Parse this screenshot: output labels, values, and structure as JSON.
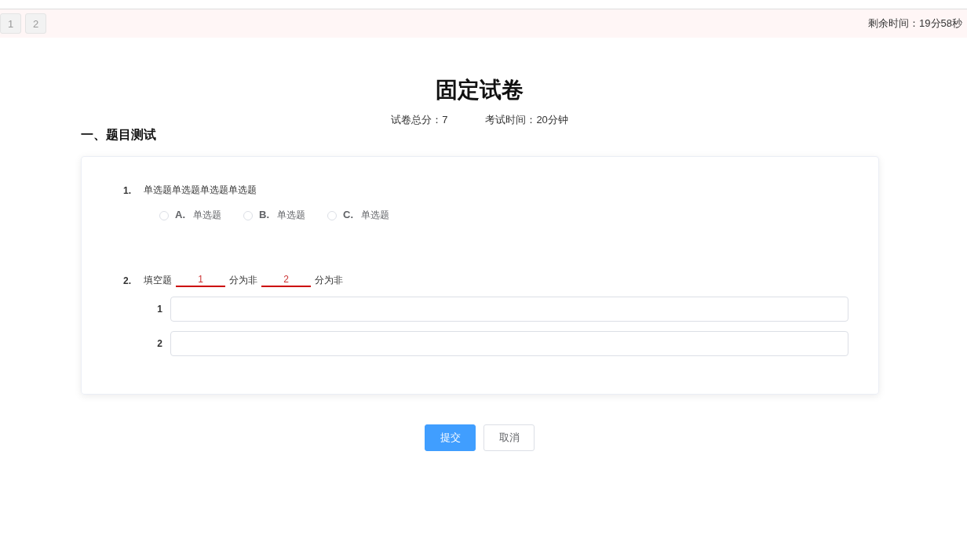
{
  "top_bar": {
    "pages": [
      {
        "label": "1",
        "selected": false
      },
      {
        "label": "2",
        "selected": false
      }
    ],
    "remaining_time": "剩余时间：19分58秒"
  },
  "title": "固定试卷",
  "meta": [
    "试卷总分：7",
    "考试时间：20分钟"
  ],
  "section": "一、题目测试",
  "questions": [
    {
      "kind": "choice",
      "number": "1.",
      "text": "单选题单选题单选题单选题",
      "options": [
        {
          "letter": "A.",
          "label": "单选题",
          "selected": false
        },
        {
          "letter": "B.",
          "label": "单选题",
          "selected": false
        },
        {
          "letter": "C.",
          "label": "单选题",
          "selected": false
        }
      ]
    },
    {
      "kind": "fill",
      "number": "2.",
      "parts": [
        {
          "kind": "text",
          "text": "填空题"
        },
        {
          "kind": "blank",
          "text": "1"
        },
        {
          "kind": "text",
          "text": "分为非"
        },
        {
          "kind": "blank",
          "text": "2"
        },
        {
          "kind": "text",
          "text": "分为非"
        }
      ],
      "answers": [
        {
          "label": "1"
        },
        {
          "label": "2"
        }
      ]
    }
  ],
  "buttons": {
    "submit": "提交",
    "cancel": "取消"
  }
}
